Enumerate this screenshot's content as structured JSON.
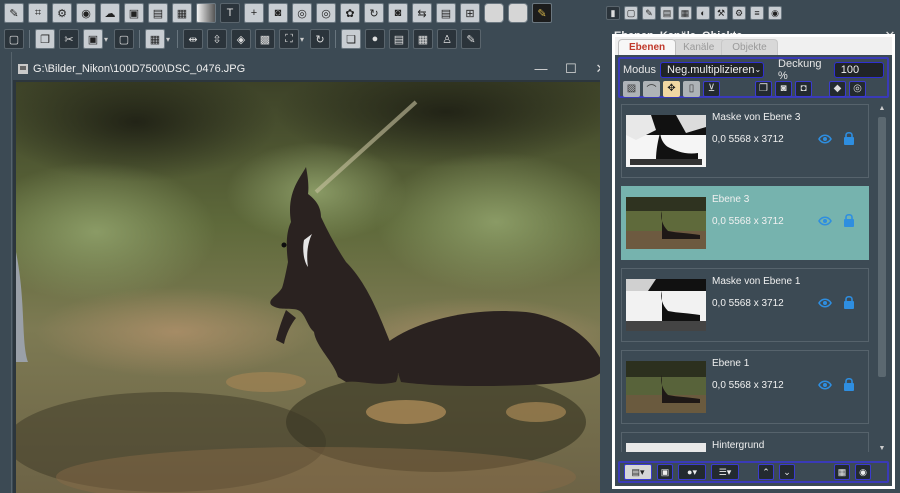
{
  "image_window": {
    "title": "G:\\Bilder_Nikon\\100D7500\\DSC_0476.JPG",
    "minimize": "—",
    "maximize": "☐",
    "close": "✕"
  },
  "panel": {
    "title": "Ebenen, Kanäle, Objekte",
    "close": "✕",
    "tabs": [
      {
        "label": "Ebenen",
        "active": true
      },
      {
        "label": "Kanäle",
        "active": false
      },
      {
        "label": "Objekte",
        "active": false
      }
    ],
    "mode_label": "Modus",
    "mode_value": "Neg.multiplizieren",
    "opacity_label": "Deckung %",
    "opacity_value": "100",
    "layers": [
      {
        "name": "Maske von Ebene 3",
        "info": "0,0  5568 x 3712",
        "selected": false,
        "thumb": "mask"
      },
      {
        "name": "Ebene 3",
        "info": "0,0  5568 x 3712",
        "selected": true,
        "thumb": "photo"
      },
      {
        "name": "Maske von Ebene 1",
        "info": "0,0  5568 x 3712",
        "selected": false,
        "thumb": "mask"
      },
      {
        "name": "Ebene 1",
        "info": "0,0  5568 x 3712",
        "selected": false,
        "thumb": "photo"
      },
      {
        "name": "Hintergrund",
        "info": "",
        "selected": false,
        "thumb": "photo"
      }
    ]
  },
  "colors": {
    "app_bg": "#3c4a54",
    "selected_layer": "#76b3ae",
    "active_tab_text": "#c0392b",
    "accent_border": "#3a3ab8",
    "icon_blue": "#2e8ee0"
  }
}
